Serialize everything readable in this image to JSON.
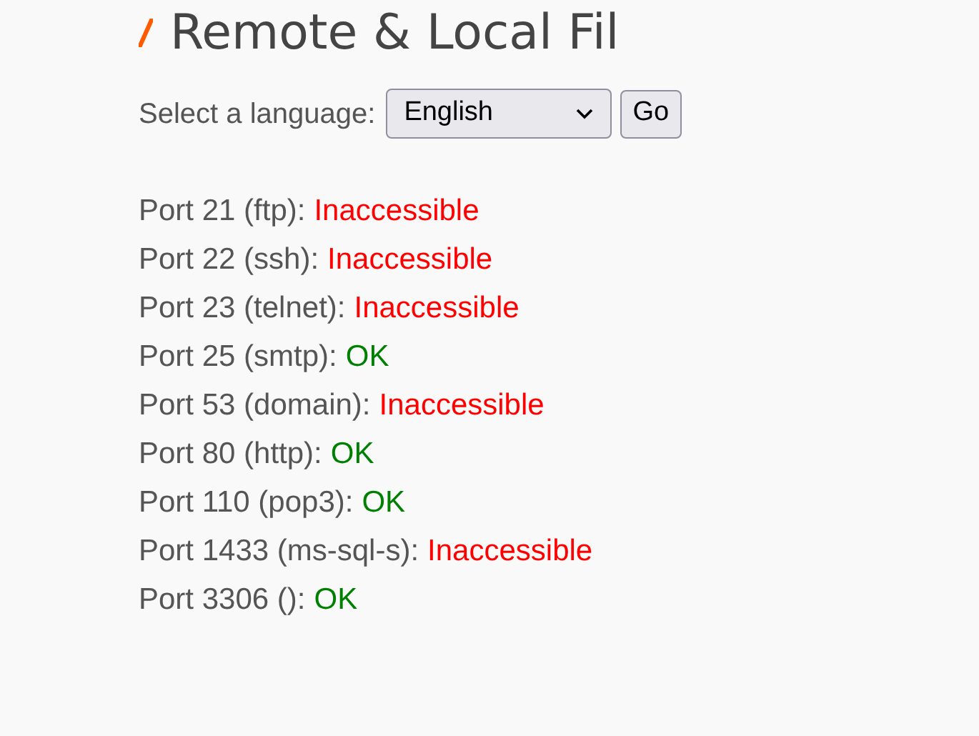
{
  "heading": "Remote & Local Fil",
  "language_form": {
    "label": "Select a language:",
    "value": "English",
    "button": "Go"
  },
  "ports": [
    {
      "label": "Port 21 (ftp):",
      "status": "Inaccessible",
      "kind": "fail"
    },
    {
      "label": "Port 22 (ssh):",
      "status": "Inaccessible",
      "kind": "fail"
    },
    {
      "label": "Port 23 (telnet):",
      "status": "Inaccessible",
      "kind": "fail"
    },
    {
      "label": "Port 25 (smtp):",
      "status": "OK",
      "kind": "ok"
    },
    {
      "label": "Port 53 (domain):",
      "status": "Inaccessible",
      "kind": "fail"
    },
    {
      "label": "Port 80 (http):",
      "status": "OK",
      "kind": "ok"
    },
    {
      "label": "Port 110 (pop3):",
      "status": "OK",
      "kind": "ok"
    },
    {
      "label": "Port 1433 (ms-sql-s):",
      "status": "Inaccessible",
      "kind": "fail"
    },
    {
      "label": "Port 3306 ():",
      "status": "OK",
      "kind": "ok"
    }
  ]
}
